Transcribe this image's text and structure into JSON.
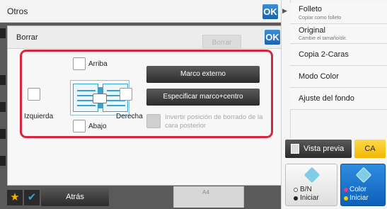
{
  "otros": {
    "title": "Otros",
    "ok_label": "OK"
  },
  "dialog": {
    "title": "Borrar",
    "borrar_button": "Borrar",
    "ok_label": "OK",
    "positions": {
      "top": "Arriba",
      "left": "Izquierda",
      "right": "Derecha",
      "bottom": "Abajo"
    },
    "buttons": {
      "outer_frame": "Marco externo",
      "frame_center": "Especificar marco+centro"
    },
    "invert_back": "Invertir posición de borrado de la cara posterior"
  },
  "bottom": {
    "back_label": "Atrás",
    "ghost_text": "A4"
  },
  "right_panel": {
    "items": [
      {
        "main": "Folleto",
        "sub": "Copiar como folleto"
      },
      {
        "main": "Original",
        "sub": "Cambie el tamaño/dir."
      },
      {
        "main": "Copia 2-Caras",
        "sub": ""
      },
      {
        "main": "Modo Color",
        "sub": ""
      },
      {
        "main": "Ajuste del fondo",
        "sub": ""
      }
    ],
    "preview_label": "Vista previa",
    "ca_label": "CA",
    "start_bw": {
      "line1": "B/N",
      "line2": "Iniciar"
    },
    "start_color": {
      "line1": "Color",
      "line2": "Iniciar"
    }
  },
  "colors": {
    "accent_blue": "#1a64b0",
    "highlight_red": "#d6263f",
    "ca_yellow": "#f2b800"
  }
}
